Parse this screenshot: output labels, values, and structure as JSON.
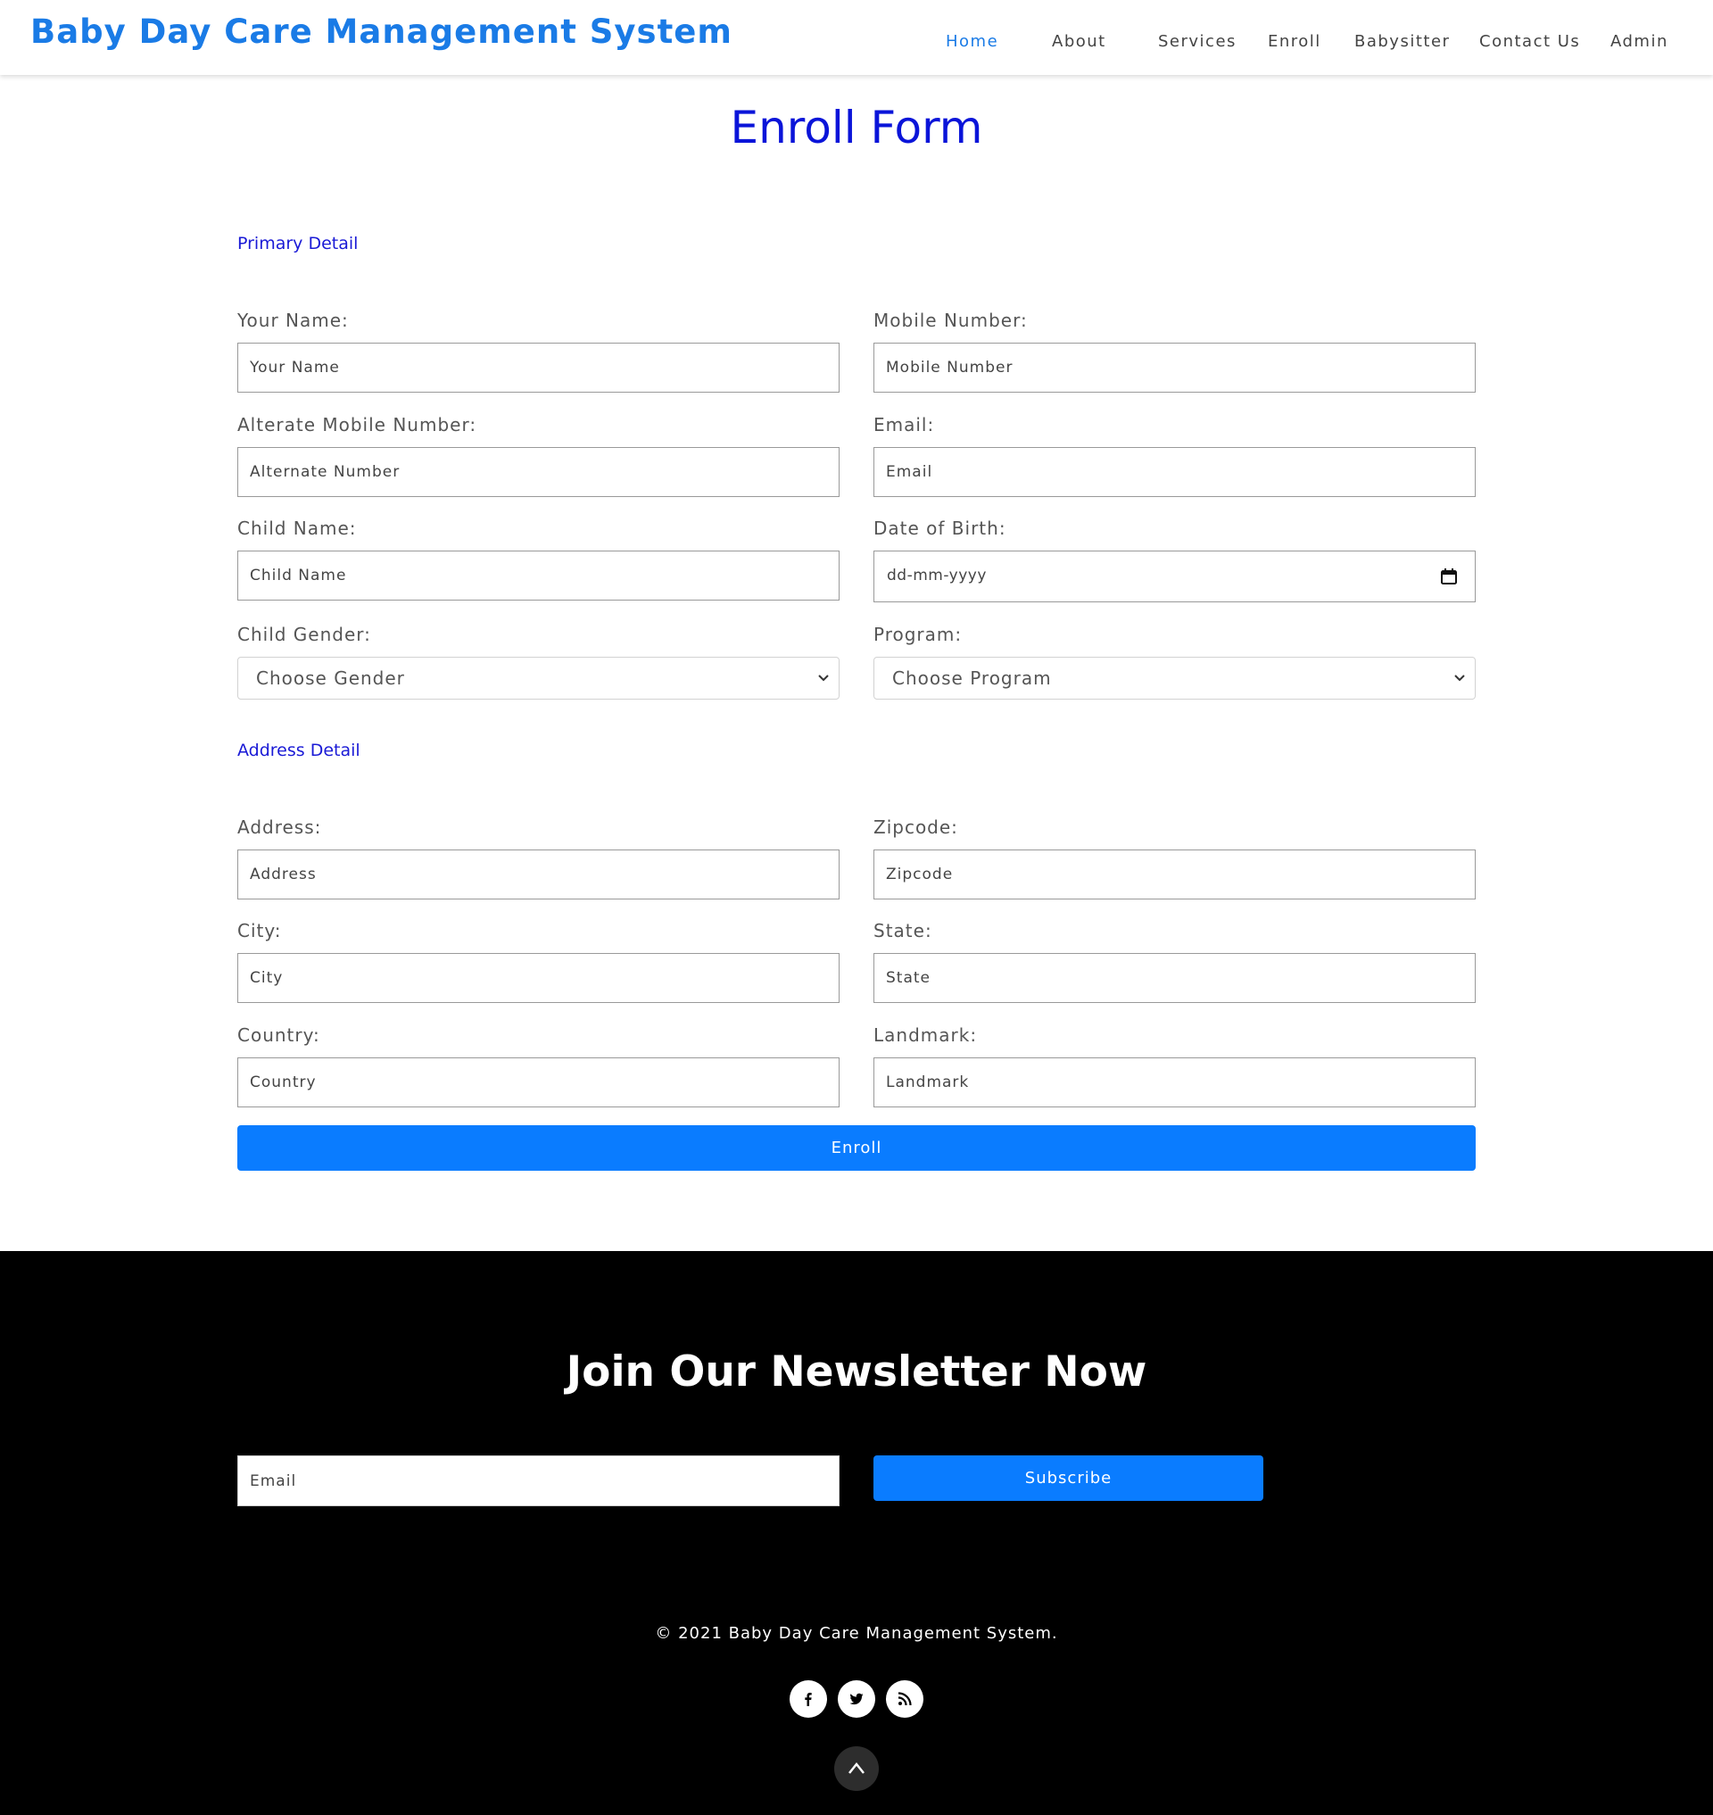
{
  "header": {
    "brand": "Baby Day Care Management System",
    "nav": [
      {
        "label": "Home",
        "active": true
      },
      {
        "label": "About",
        "active": false
      },
      {
        "label": "Services",
        "active": false
      },
      {
        "label": "Enroll",
        "active": false
      },
      {
        "label": "Babysitter",
        "active": false
      },
      {
        "label": "Contact Us",
        "active": false
      },
      {
        "label": "Admin",
        "active": false
      }
    ]
  },
  "form": {
    "title": "Enroll Form",
    "primary_section": "Primary Detail",
    "address_section": "Address Detail",
    "fields": {
      "your_name": {
        "label": "Your Name:",
        "placeholder": "Your Name"
      },
      "mobile": {
        "label": "Mobile Number:",
        "placeholder": "Mobile Number"
      },
      "alt_mobile": {
        "label": "Alterate Mobile Number:",
        "placeholder": "Alternate Number"
      },
      "email": {
        "label": "Email:",
        "placeholder": "Email"
      },
      "child_name": {
        "label": "Child Name:",
        "placeholder": "Child Name"
      },
      "dob": {
        "label": "Date of Birth:",
        "placeholder": "dd-mm-yyyy"
      },
      "child_gender": {
        "label": "Child Gender:",
        "value": "Choose Gender"
      },
      "program": {
        "label": "Program:",
        "value": "Choose Program"
      },
      "address": {
        "label": "Address:",
        "placeholder": "Address"
      },
      "zipcode": {
        "label": "Zipcode:",
        "placeholder": "Zipcode"
      },
      "city": {
        "label": "City:",
        "placeholder": "City"
      },
      "state": {
        "label": "State:",
        "placeholder": "State"
      },
      "country": {
        "label": "Country:",
        "placeholder": "Country"
      },
      "landmark": {
        "label": "Landmark:",
        "placeholder": "Landmark"
      }
    },
    "submit_label": "Enroll"
  },
  "footer": {
    "newsletter_title": "Join Our Newsletter Now",
    "email_placeholder": "Email",
    "subscribe_label": "Subscribe",
    "copyright": "© 2021 Baby Day Care Management System.",
    "social_icons": [
      "facebook-icon",
      "twitter-icon",
      "rss-icon"
    ],
    "scroll_top_icon": "chevron-up-icon"
  },
  "colors": {
    "brand": "#1a7be6",
    "title": "#0a14d9",
    "button": "#0a7cff",
    "footer_bg": "#000000"
  }
}
